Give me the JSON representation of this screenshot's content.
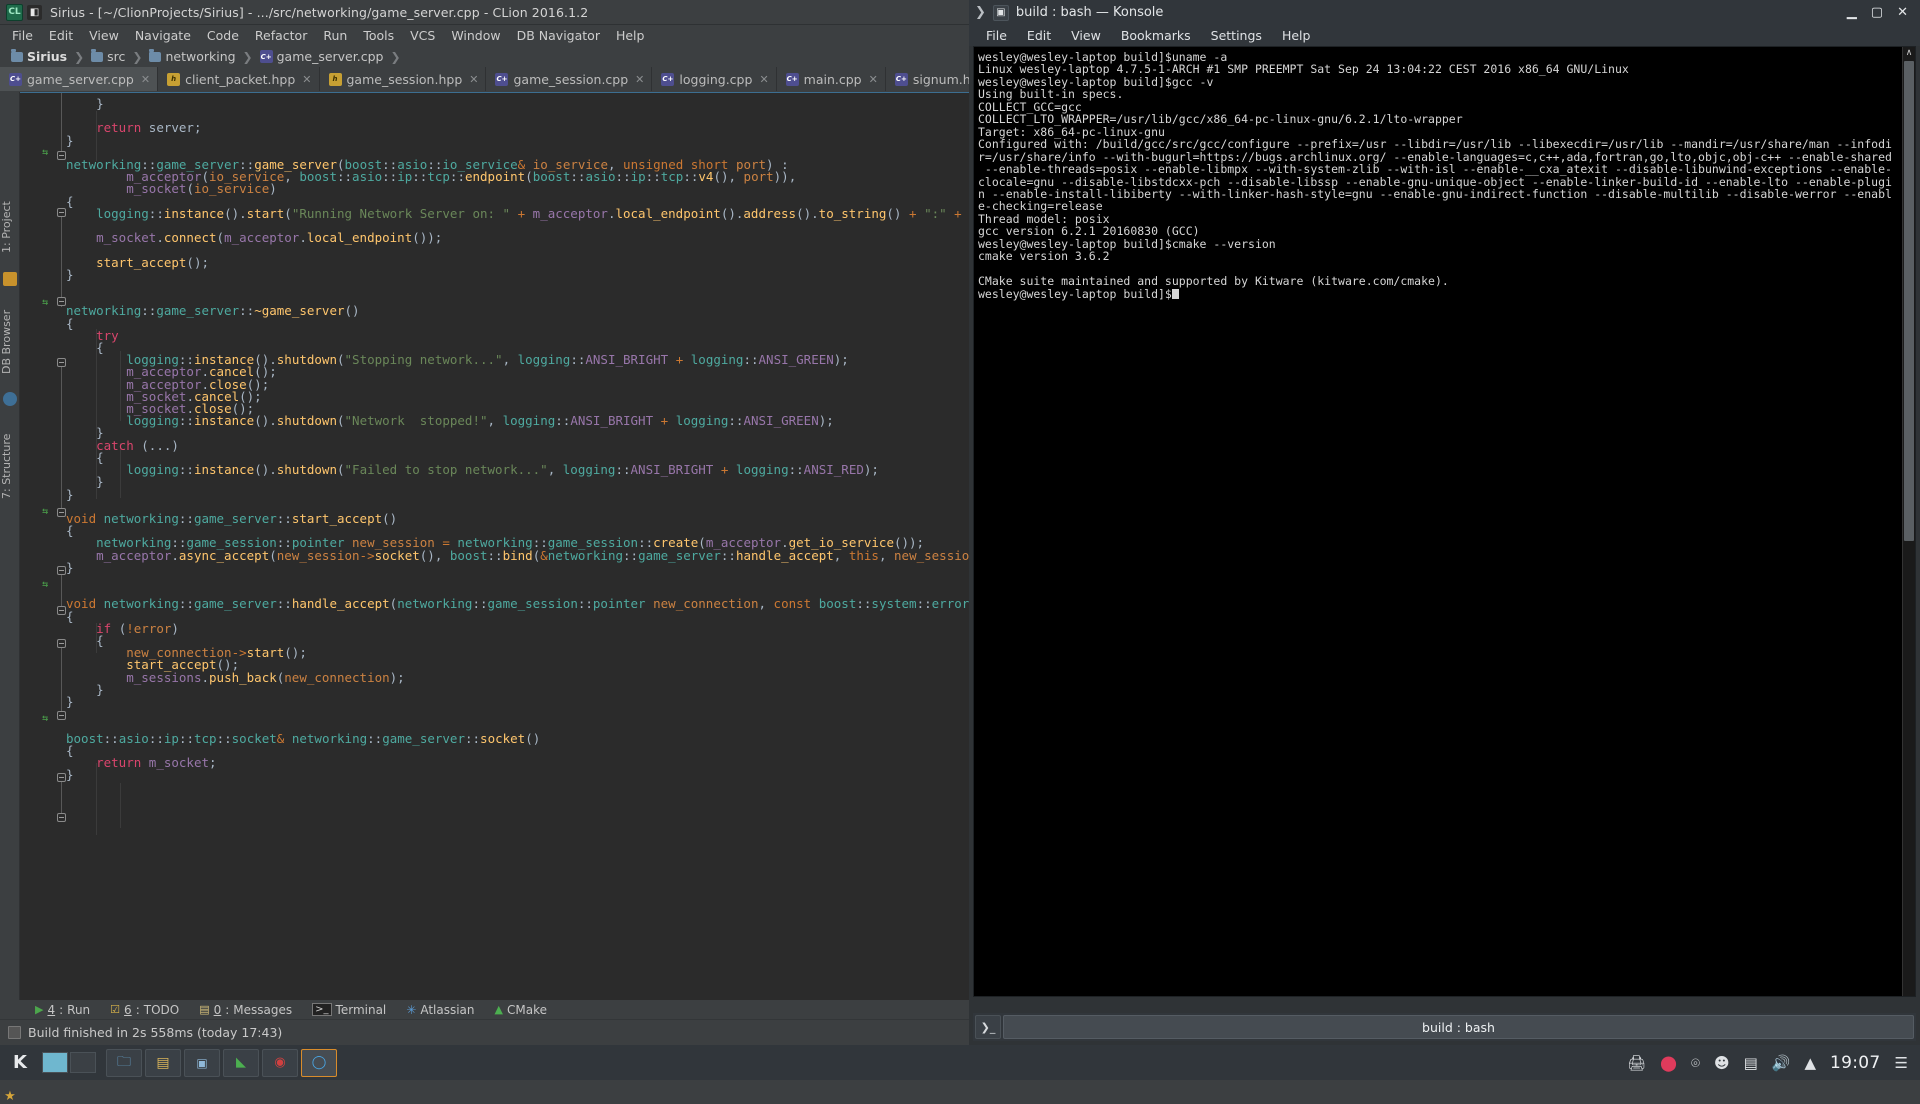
{
  "clion": {
    "window_title": "Sirius - [~/ClionProjects/Sirius] - .../src/networking/game_server.cpp - CLion 2016.1.2",
    "menus": [
      "File",
      "Edit",
      "View",
      "Navigate",
      "Code",
      "Refactor",
      "Run",
      "Tools",
      "VCS",
      "Window",
      "DB Navigator",
      "Help"
    ],
    "breadcrumb": [
      {
        "label": "Sirius",
        "icon": "folder-icon"
      },
      {
        "label": "src",
        "icon": "folder-icon"
      },
      {
        "label": "networking",
        "icon": "folder-icon"
      },
      {
        "label": "game_server.cpp",
        "icon": "cpp-file-icon"
      }
    ],
    "tabs": [
      {
        "label": "game_server.cpp",
        "icon": "cpp-file-icon",
        "active": true
      },
      {
        "label": "client_packet.hpp",
        "icon": "hpp-file-icon",
        "active": false
      },
      {
        "label": "game_session.hpp",
        "icon": "hpp-file-icon",
        "active": false
      },
      {
        "label": "game_session.cpp",
        "icon": "cpp-file-icon",
        "active": false
      },
      {
        "label": "logging.cpp",
        "icon": "cpp-file-icon",
        "active": false
      },
      {
        "label": "main.cpp",
        "icon": "cpp-file-icon",
        "active": false
      },
      {
        "label": "signum.h",
        "icon": "cpp-file-icon",
        "active": false
      }
    ],
    "left_rail": [
      {
        "label": "1: Project"
      },
      {
        "label": "DB Browser"
      },
      {
        "label": "7: Structure"
      },
      {
        "label": "2: Favorites"
      }
    ],
    "tool_windows": [
      {
        "num": "4",
        "label": "Run",
        "icon": "run-icon"
      },
      {
        "num": "6",
        "label": "TODO",
        "icon": "todo-icon"
      },
      {
        "num": "0",
        "label": "Messages",
        "icon": "messages-icon"
      },
      {
        "num": "",
        "label": "Terminal",
        "icon": "terminal-icon"
      },
      {
        "num": "",
        "label": "Atlassian",
        "icon": "atlassian-icon"
      },
      {
        "num": "",
        "label": "CMake",
        "icon": "cmake-icon"
      }
    ],
    "status_text": "Build finished in 2s 558ms (today 17:43)"
  },
  "konsole": {
    "window_title": "build : bash — Konsole",
    "menus": [
      "File",
      "Edit",
      "View",
      "Bookmarks",
      "Settings",
      "Help"
    ],
    "window_buttons": [
      "minimize",
      "maximize",
      "close"
    ],
    "tab_label": "build : bash",
    "new_tab_label": "new-tab",
    "terminal_lines": [
      "wesley@wesley-laptop build]$uname -a",
      "Linux wesley-laptop 4.7.5-1-ARCH #1 SMP PREEMPT Sat Sep 24 13:04:22 CEST 2016 x86_64 GNU/Linux",
      "wesley@wesley-laptop build]$gcc -v",
      "Using built-in specs.",
      "COLLECT_GCC=gcc",
      "COLLECT_LTO_WRAPPER=/usr/lib/gcc/x86_64-pc-linux-gnu/6.2.1/lto-wrapper",
      "Target: x86_64-pc-linux-gnu",
      "Configured with: /build/gcc/src/gcc/configure --prefix=/usr --libdir=/usr/lib --libexecdir=/usr/lib --mandir=/usr/share/man --infodi",
      "r=/usr/share/info --with-bugurl=https://bugs.archlinux.org/ --enable-languages=c,c++,ada,fortran,go,lto,objc,obj-c++ --enable-shared",
      " --enable-threads=posix --enable-libmpx --with-system-zlib --with-isl --enable-__cxa_atexit --disable-libunwind-exceptions --enable-",
      "clocale=gnu --disable-libstdcxx-pch --disable-libssp --enable-gnu-unique-object --enable-linker-build-id --enable-lto --enable-plugi",
      "n --enable-install-libiberty --with-linker-hash-style=gnu --enable-gnu-indirect-function --disable-multilib --disable-werror --enabl",
      "e-checking=release",
      "Thread model: posix",
      "gcc version 6.2.1 20160830 (GCC)",
      "wesley@wesley-laptop build]$cmake --version",
      "cmake version 3.6.2",
      "",
      "CMake suite maintained and supported by Kitware (kitware.com/cmake).",
      "wesley@wesley-laptop build]$"
    ]
  },
  "taskbar": {
    "launcher_label": "K",
    "clock": "19:07",
    "tray_icons": [
      "printer-icon",
      "battery-icon",
      "network-wifi-icon",
      "user-status-icon",
      "clipboard-icon",
      "volume-icon",
      "show-hidden-icon",
      "hamburger-icon"
    ]
  },
  "colors": {
    "clion_bg": "#3c3f41",
    "editor_bg": "#2b2b2b",
    "konsole_bg": "#31363b",
    "terminal_bg": "#000000",
    "accent": "#6fb7cf"
  }
}
